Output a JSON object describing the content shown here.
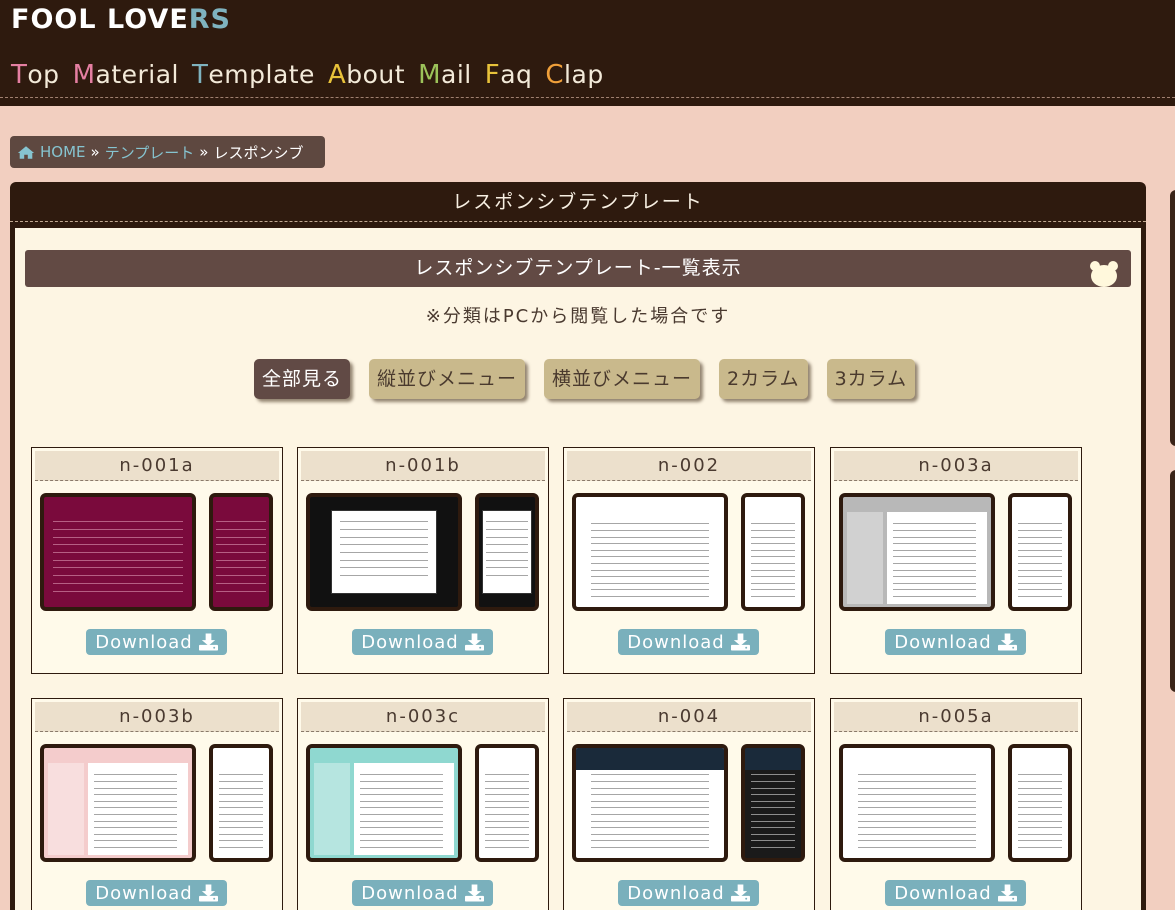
{
  "header": {
    "logo_main": "FOOL LOVE",
    "logo_accent": "RS",
    "nav": [
      {
        "first": "T",
        "rest": "op",
        "color": "#e57fa2"
      },
      {
        "first": "M",
        "rest": "aterial",
        "color": "#e57fa2"
      },
      {
        "first": "T",
        "rest": "emplate",
        "color": "#7fb3bf"
      },
      {
        "first": "A",
        "rest": "bout",
        "color": "#e8c23a"
      },
      {
        "first": "M",
        "rest": "ail",
        "color": "#9cc25a"
      },
      {
        "first": "F",
        "rest": "aq",
        "color": "#e8c23a"
      },
      {
        "first": "C",
        "rest": "lap",
        "color": "#f0a03a"
      }
    ]
  },
  "breadcrumb": {
    "home": "HOME",
    "sep": "»",
    "category": "テンプレート",
    "current": "レスポンシブ"
  },
  "panel": {
    "title": "レスポンシブテンプレート",
    "subtitle": "レスポンシブテンプレート-一覧表示",
    "note": "※分類はPCから閲覧した場合です"
  },
  "filters": [
    "全部見る",
    "縦並びメニュー",
    "横並びメニュー",
    "2カラム",
    "3カラム"
  ],
  "download_label": "Download",
  "templates": [
    {
      "id": "n-001a",
      "pc_bg": "#7a0a3c",
      "sp_bg": "#7a0a3c",
      "style": "dark"
    },
    {
      "id": "n-001b",
      "pc_bg": "#111111",
      "sp_bg": "#111111",
      "style": "darkframe"
    },
    {
      "id": "n-002",
      "pc_bg": "#ffffff",
      "sp_bg": "#ffffff",
      "style": "light"
    },
    {
      "id": "n-003a",
      "pc_bg": "#b8b8b8",
      "sp_bg": "#ffffff",
      "style": "gray"
    },
    {
      "id": "n-003b",
      "pc_bg": "#f4cccc",
      "sp_bg": "#ffffff",
      "style": "pink"
    },
    {
      "id": "n-003c",
      "pc_bg": "#8fd8d0",
      "sp_bg": "#ffffff",
      "style": "teal"
    },
    {
      "id": "n-004",
      "pc_bg": "#ffffff",
      "sp_bg": "#1a1a1a",
      "style": "bubbles"
    },
    {
      "id": "n-005a",
      "pc_bg": "#ffffff",
      "sp_bg": "#ffffff",
      "style": "light"
    }
  ]
}
